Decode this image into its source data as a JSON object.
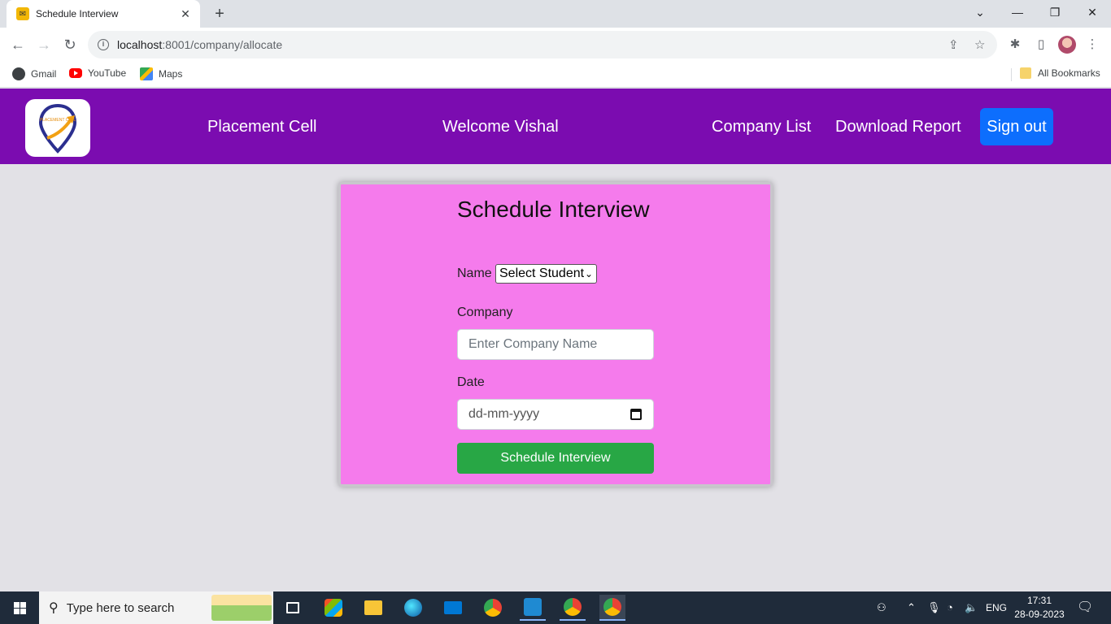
{
  "browser": {
    "tab_title": "Schedule Interview",
    "url_host": "localhost",
    "url_path": ":8001/company/allocate",
    "bookmarks": [
      "Gmail",
      "YouTube",
      "Maps"
    ],
    "all_bookmarks": "All Bookmarks"
  },
  "navbar": {
    "brand": "Placement Cell",
    "welcome": "Welcome Vishal",
    "links": [
      "Company List",
      "Download Report"
    ],
    "signout": "Sign out",
    "logo_text": "PLACEMENT CELL",
    "color": "#7b0cb0"
  },
  "form": {
    "title": "Schedule Interview",
    "name_label": "Name",
    "student_select": "Select Student",
    "company_label": "Company",
    "company_placeholder": "Enter Company Name",
    "date_label": "Date",
    "date_placeholder": "dd-mm-yyyy",
    "submit": "Schedule Interview",
    "card_color": "#f57bec",
    "submit_color": "#28a745"
  },
  "taskbar": {
    "search_placeholder": "Type here to search",
    "language": "ENG",
    "time": "17:31",
    "date": "28-09-2023"
  }
}
